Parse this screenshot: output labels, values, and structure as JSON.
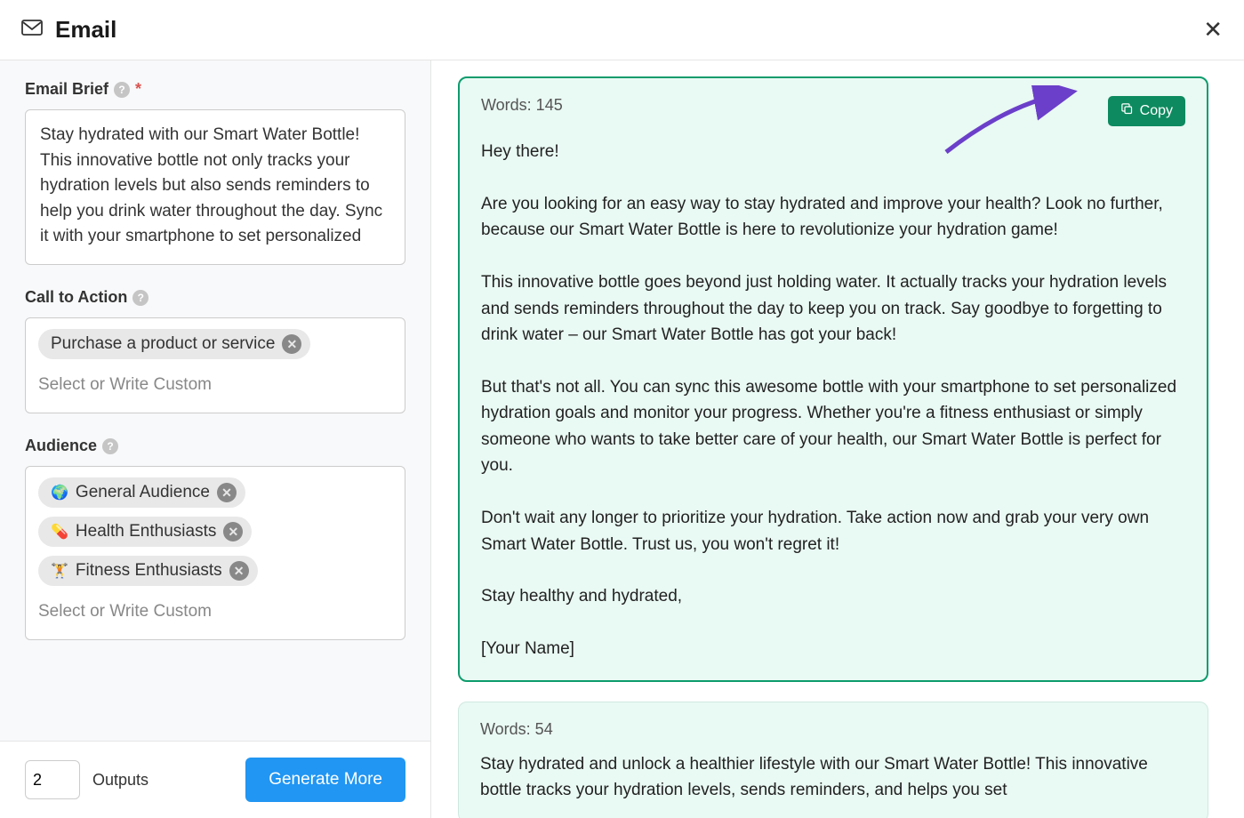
{
  "header": {
    "title": "Email"
  },
  "form": {
    "brief_label": "Email Brief",
    "brief_value": "Stay hydrated with our Smart Water Bottle! This innovative bottle not only tracks your hydration levels but also sends reminders to help you drink water throughout the day. Sync it with your smartphone to set personalized",
    "cta_label": "Call to Action",
    "cta_tag": "Purchase a product or service",
    "cta_placeholder": "Select or Write Custom",
    "audience_label": "Audience",
    "audience_tags": [
      {
        "emoji": "🌍",
        "label": "General Audience"
      },
      {
        "emoji": "💊",
        "label": "Health Enthusiasts"
      },
      {
        "emoji": "🏋️",
        "label": "Fitness Enthusiasts"
      }
    ],
    "audience_placeholder": "Select or Write Custom"
  },
  "footer": {
    "outputs_count": "2",
    "outputs_label": "Outputs",
    "generate_label": "Generate More"
  },
  "outputs": [
    {
      "words_label": "Words: 145",
      "copy_label": "Copy",
      "body": "Hey there!\n\nAre you looking for an easy way to stay hydrated and improve your health? Look no further, because our Smart Water Bottle is here to revolutionize your hydration game!\n\nThis innovative bottle goes beyond just holding water. It actually tracks your hydration levels and sends reminders throughout the day to keep you on track. Say goodbye to forgetting to drink water – our Smart Water Bottle has got your back!\n\nBut that's not all. You can sync this awesome bottle with your smartphone to set personalized hydration goals and monitor your progress. Whether you're a fitness enthusiast or simply someone who wants to take better care of your health, our Smart Water Bottle is perfect for you.\n\nDon't wait any longer to prioritize your hydration. Take action now and grab your very own Smart Water Bottle. Trust us, you won't regret it!\n\nStay healthy and hydrated,\n\n[Your Name]"
    },
    {
      "words_label": "Words: 54",
      "body": "Stay hydrated and unlock a healthier lifestyle with our Smart Water Bottle! This innovative bottle tracks your hydration levels, sends reminders, and helps you set"
    }
  ]
}
